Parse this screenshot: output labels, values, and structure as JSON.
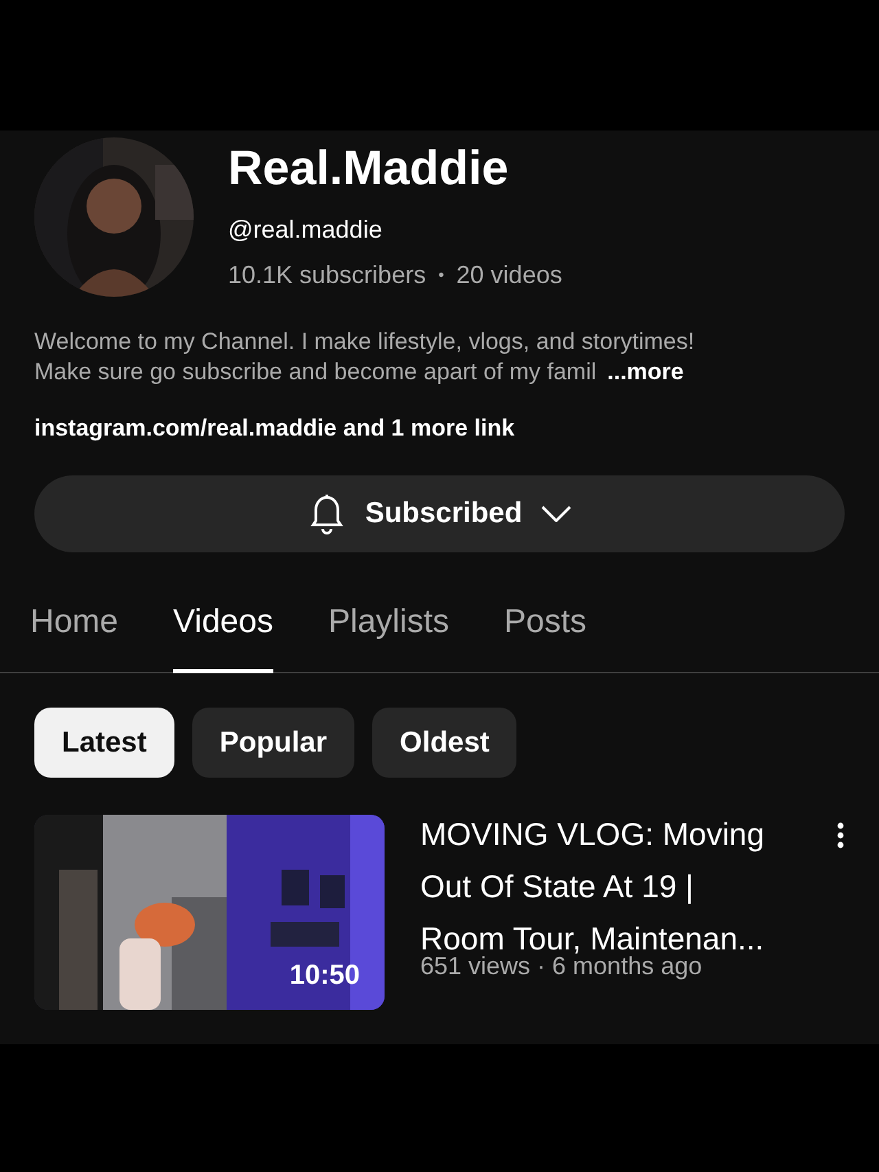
{
  "channel": {
    "name": "Real.Maddie",
    "handle": "@real.maddie",
    "subscribers": "10.1K subscribers",
    "separator": "•",
    "videos": "20 videos",
    "description": [
      "Welcome to my Channel. I make lifestyle, vlogs, and storytimes!",
      "Make sure go subscribe and become apart of my famil"
    ],
    "more": "...more",
    "links": "instagram.com/real.maddie and 1 more link"
  },
  "subscribe_button": {
    "label": "Subscribed",
    "subscribed": true
  },
  "tabs": [
    {
      "label": "Home",
      "selected": false
    },
    {
      "label": "Videos",
      "selected": true
    },
    {
      "label": "Playlists",
      "selected": false
    },
    {
      "label": "Posts",
      "selected": false
    }
  ],
  "chips": [
    {
      "label": "Latest",
      "selected": true
    },
    {
      "label": "Popular",
      "selected": false
    },
    {
      "label": "Oldest",
      "selected": false
    }
  ],
  "videos": [
    {
      "thumbnail": {
        "kind": "picture"
      },
      "duration": "10:50",
      "title": [
        "MOVING VLOG: Moving",
        "Out Of State At 19 |",
        "Room Tour, Maintenan..."
      ],
      "meta": "651 views · 6 months ago"
    }
  ]
}
